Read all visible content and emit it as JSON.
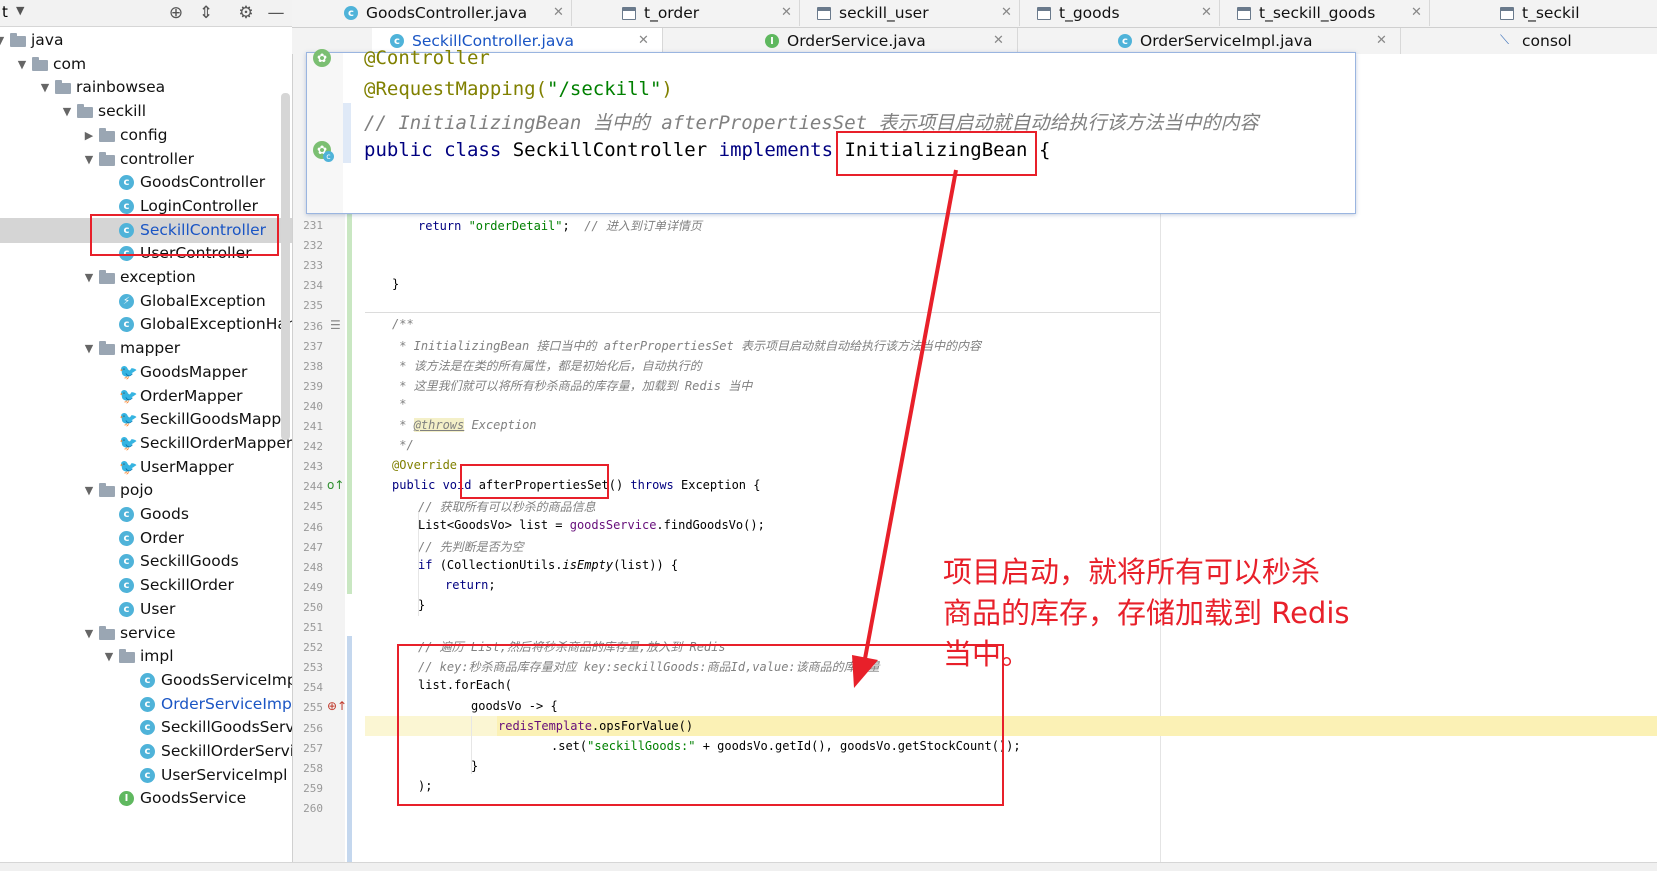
{
  "project_panel": {
    "toolbar_label": "t",
    "tree": [
      {
        "label": "java",
        "level": 0,
        "type": "folder",
        "expanded": true
      },
      {
        "label": "com",
        "level": 1,
        "type": "folder",
        "expanded": true
      },
      {
        "label": "rainbowsea",
        "level": 2,
        "type": "folder",
        "expanded": true
      },
      {
        "label": "seckill",
        "level": 3,
        "type": "folder",
        "expanded": true
      },
      {
        "label": "config",
        "level": 4,
        "type": "folder",
        "expanded": false
      },
      {
        "label": "controller",
        "level": 4,
        "type": "folder",
        "expanded": true
      },
      {
        "label": "GoodsController",
        "level": 5,
        "type": "class"
      },
      {
        "label": "LoginController",
        "level": 5,
        "type": "class"
      },
      {
        "label": "SeckillController",
        "level": 5,
        "type": "class",
        "selected": true
      },
      {
        "label": "UserController",
        "level": 5,
        "type": "class"
      },
      {
        "label": "exception",
        "level": 4,
        "type": "folder",
        "expanded": true
      },
      {
        "label": "GlobalException",
        "level": 5,
        "type": "exception"
      },
      {
        "label": "GlobalExceptionHandl",
        "level": 5,
        "type": "class"
      },
      {
        "label": "mapper",
        "level": 4,
        "type": "folder",
        "expanded": true
      },
      {
        "label": "GoodsMapper",
        "level": 5,
        "type": "mapper"
      },
      {
        "label": "OrderMapper",
        "level": 5,
        "type": "mapper"
      },
      {
        "label": "SeckillGoodsMapper",
        "level": 5,
        "type": "mapper"
      },
      {
        "label": "SeckillOrderMapper",
        "level": 5,
        "type": "mapper"
      },
      {
        "label": "UserMapper",
        "level": 5,
        "type": "mapper"
      },
      {
        "label": "pojo",
        "level": 4,
        "type": "folder",
        "expanded": true
      },
      {
        "label": "Goods",
        "level": 5,
        "type": "class"
      },
      {
        "label": "Order",
        "level": 5,
        "type": "class"
      },
      {
        "label": "SeckillGoods",
        "level": 5,
        "type": "class"
      },
      {
        "label": "SeckillOrder",
        "level": 5,
        "type": "class"
      },
      {
        "label": "User",
        "level": 5,
        "type": "class"
      },
      {
        "label": "service",
        "level": 4,
        "type": "folder",
        "expanded": true
      },
      {
        "label": "impl",
        "level": 5,
        "type": "folder",
        "expanded": true
      },
      {
        "label": "GoodsServiceImpl",
        "level": 6,
        "type": "class"
      },
      {
        "label": "OrderServiceImpl",
        "level": 6,
        "type": "class",
        "blue": true
      },
      {
        "label": "SeckillGoodsServic",
        "level": 6,
        "type": "class"
      },
      {
        "label": "SeckillOrderService",
        "level": 6,
        "type": "class"
      },
      {
        "label": "UserServiceImpl",
        "level": 6,
        "type": "class"
      },
      {
        "label": "GoodsService",
        "level": 5,
        "type": "interface"
      }
    ]
  },
  "tabs_row1": [
    {
      "label": "GoodsController.java",
      "icon": "class-icon"
    },
    {
      "label": "t_order",
      "icon": "table-icon"
    },
    {
      "label": "seckill_user",
      "icon": "table-icon"
    },
    {
      "label": "t_goods",
      "icon": "table-icon"
    },
    {
      "label": "t_seckill_goods",
      "icon": "table-icon"
    },
    {
      "label": "t_seckil",
      "icon": "table-icon"
    }
  ],
  "tabs_row2": [
    {
      "label": "SeckillController.java",
      "icon": "class-icon",
      "active": true
    },
    {
      "label": "OrderService.java",
      "icon": "interface-icon"
    },
    {
      "label": "OrderServiceImpl.java",
      "icon": "class-icon"
    },
    {
      "label": "consol",
      "icon": "console-icon"
    }
  ],
  "popup": {
    "line1": "@Controller",
    "line2_ann": "@RequestMapping(",
    "line2_str": "\"/seckill\"",
    "line2_end": ")",
    "line3": "// InitializingBean 当中的 afterPropertiesSet 表示项目启动就自动给执行该方法当中的内容",
    "line4_kw": "public class ",
    "line4_name": "SeckillController ",
    "line4_kw2": "implements ",
    "line4_iface": "InitializingBean",
    "line4_end": " {"
  },
  "line_numbers": [
    "231",
    "232",
    "233",
    "234",
    "235",
    "236",
    "237",
    "238",
    "239",
    "240",
    "241",
    "242",
    "243",
    "244",
    "245",
    "246",
    "247",
    "248",
    "249",
    "250",
    "251",
    "252",
    "253",
    "254",
    "255",
    "256",
    "257",
    "258",
    "259",
    "260"
  ],
  "code": {
    "l231_kw": "return ",
    "l231_str": "\"orderDetail\"",
    "l231_rest": ";  ",
    "l231_cmt": "// 进入到订单详情页",
    "l234": "}",
    "l236": "/**",
    "l237": " * InitializingBean 接口当中的 afterPropertiesSet 表示项目启动就自动给执行该方法当中的内容",
    "l238": " * 该方法是在类的所有属性，都是初始化后，自动执行的",
    "l239": " * 这里我们就可以将所有秒杀商品的库存量，加载到 Redis 当中",
    "l240": " *",
    "l241_pre": " * ",
    "l241_tag": "@throws",
    "l241_rest": " Exception",
    "l242": " */",
    "l243": "@Override",
    "l244_kw": "public void ",
    "l244_name": "afterPropertiesSet() ",
    "l244_kw2": "throws ",
    "l244_rest": "Exception {",
    "l245": "// 获取所有可以秒杀的商品信息",
    "l246_a": "List<GoodsVo> list = ",
    "l246_fld": "goodsService",
    "l246_b": ".findGoodsVo();",
    "l247": "// 先判断是否为空",
    "l248_kw": "if ",
    "l248_a": "(CollectionUtils.",
    "l248_m": "isEmpty",
    "l248_b": "(list)) {",
    "l249_kw": "return",
    "l249_b": ";",
    "l250": "}",
    "l252": "// 遍历 List,然后将秒杀商品的库存量,放入到 Redis",
    "l253": "// key:秒杀商品库存量对应 key:seckillGoods:商品Id,value:该商品的库存量",
    "l254": "list.forEach(",
    "l255": "goodsVo -> {",
    "l256_fld": "redisTemplate",
    "l256_b": ".opsForValue()",
    "l257_a": ".set(",
    "l257_str": "\"seckillGoods:\"",
    "l257_b": " + goodsVo.getId(), goodsVo.getStockCount());",
    "l258": "}",
    "l259": ");"
  },
  "annotation_note": "项目启动，就将所有可以秒杀\n商品的库存，存储加载到 Redis\n当中。",
  "colors": {
    "highlight_red": "#e8202a",
    "keyword": "#000080",
    "string": "#008000",
    "comment": "#808080",
    "annotation": "#808000",
    "field": "#660e7a"
  }
}
